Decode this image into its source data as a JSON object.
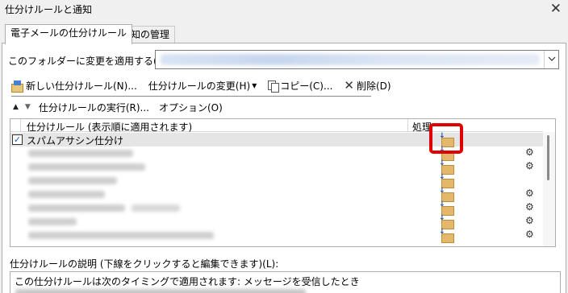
{
  "window": {
    "title": "仕分けルールと通知",
    "close_glyph": "✕"
  },
  "tabs": [
    {
      "label": "電子メールの仕分けルール",
      "active": true
    },
    {
      "label": "通知の管理",
      "active": false
    }
  ],
  "folder": {
    "label": "このフォルダーに変更を適用する(F):",
    "value_blurred": true
  },
  "toolbar": {
    "new_rule": "新しい仕分けルール(N)...",
    "change_rule": "仕分けルールの変更(H)",
    "change_rule_dropdown": "▾",
    "copy": "コピー(C)...",
    "delete": "削除(D)",
    "delete_glyph": "✕"
  },
  "run_row": {
    "up_glyph": "▲",
    "down_glyph": "▼",
    "run_rules": "仕分けルールの実行(R)...",
    "options": "オプション(O)"
  },
  "rules_list": {
    "col_rule": "仕分けルール (表示順に適用されます)",
    "col_action": "処理",
    "rows": [
      {
        "name": "スパムアサシン仕分け",
        "checked": true,
        "selected": true,
        "has_tool": true
      },
      {
        "name": "",
        "checked": false,
        "selected": false,
        "has_tool": true
      },
      {
        "name": "",
        "checked": false,
        "selected": false,
        "has_tool": false
      },
      {
        "name": "",
        "checked": false,
        "selected": false,
        "has_tool": false
      },
      {
        "name": "",
        "checked": false,
        "selected": false,
        "has_tool": true
      },
      {
        "name": "",
        "checked": false,
        "selected": false,
        "has_tool": true
      },
      {
        "name": "",
        "checked": false,
        "selected": false,
        "has_tool": true
      },
      {
        "name": "",
        "checked": false,
        "selected": false,
        "has_tool": true
      },
      {
        "name": "",
        "checked": false,
        "selected": false,
        "has_tool": true
      }
    ],
    "check_glyph": "✓",
    "tool_glyph": "⚙"
  },
  "description": {
    "label": "仕分けルールの説明 (下線をクリックすると編集できます)(L):",
    "line1": "この仕分けルールは次のタイミングで適用されます: メッセージを受信したとき"
  },
  "highlight_color": "#e00000"
}
